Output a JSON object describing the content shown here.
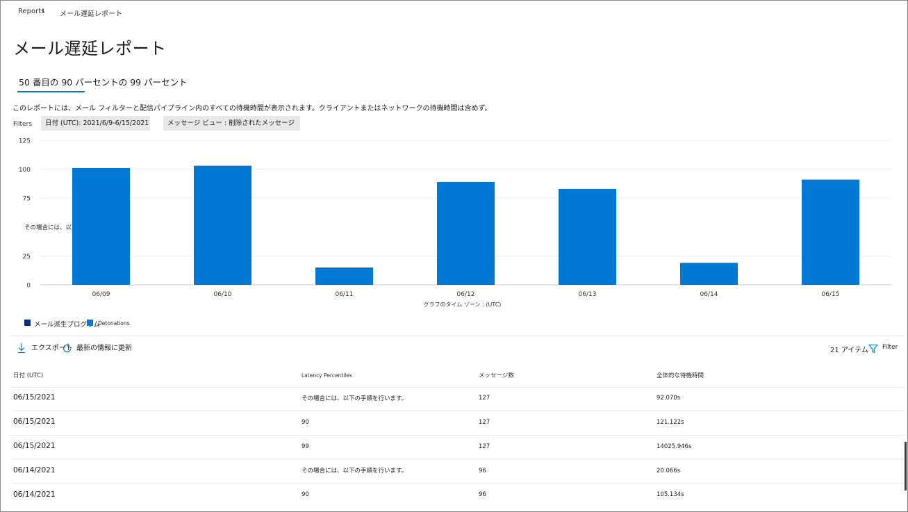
{
  "breadcrumb": {
    "root": "Reports",
    "separator": "!",
    "current": "メール遅延レポート"
  },
  "page": {
    "title": "メール遅延レポート",
    "tab_label": "50 番目の 90 パーセントの 99 パーセント",
    "description": "このレポートには、メール フィルターと配信パイプライン内のすべての待機時間が表示されます。クライアントまたはネットワークの待機時間は含めず。"
  },
  "filters": {
    "label": "Filters",
    "chips": [
      "日付 (UTC): 2021/6/9-6/15/2021",
      "メッセージ ビュー : 削除されたメッセージ"
    ]
  },
  "chart_data": {
    "type": "bar",
    "categories": [
      "06/09",
      "06/10",
      "06/11",
      "06/12",
      "06/13",
      "06/14",
      "06/15"
    ],
    "series": [
      {
        "values": [
          101,
          103,
          15,
          89,
          83,
          19,
          91
        ]
      }
    ],
    "ylim": [
      0,
      125
    ],
    "yticks": [
      "125",
      "100",
      "75",
      "25",
      "0"
    ],
    "ytick_values": [
      125,
      100,
      75,
      25,
      0
    ],
    "y_annotation": "その場合には、以下の手順を行います。",
    "xlabel": "グラフのタイム ゾーン : (UTC)",
    "grid": true,
    "bar_color": "#0078d4"
  },
  "legend": [
    {
      "label": "メール派生プログラム",
      "color": "#0b2a8c"
    },
    {
      "label": "Detonations",
      "color": "#0078d4"
    }
  ],
  "toolbar": {
    "export_label": "エクスポート",
    "refresh_label": "最新の情報に更新",
    "item_count": "21 アイテム",
    "filter_label": "Filter"
  },
  "table": {
    "headers": [
      "日付 (UTC)",
      "Latency Percentiles",
      "メッセージ数",
      "全体的な待機時間"
    ],
    "rows": [
      [
        "06/15/2021",
        "その場合には、以下の手順を行います。",
        "127",
        "92.070s"
      ],
      [
        "06/15/2021",
        "90",
        "127",
        "121.122s"
      ],
      [
        "06/15/2021",
        "99",
        "127",
        "14025.946s"
      ],
      [
        "06/14/2021",
        "その場合には、以下の手順を行います。",
        "96",
        "20.066s"
      ],
      [
        "06/14/2021",
        "90",
        "96",
        "105.134s"
      ]
    ]
  }
}
